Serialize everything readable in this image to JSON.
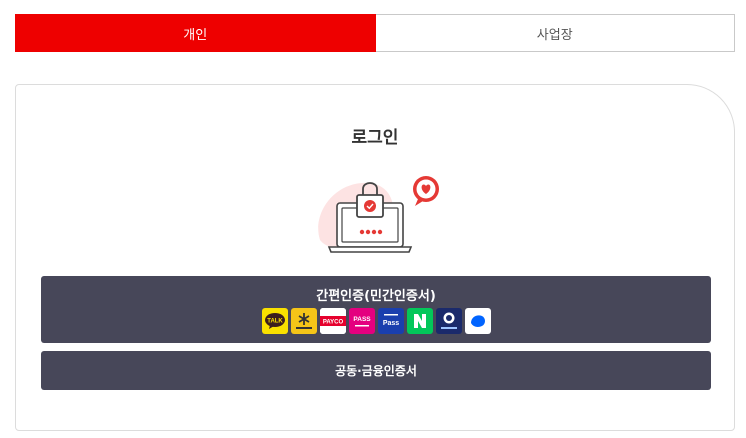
{
  "tabs": [
    {
      "label": "개인",
      "active": true
    },
    {
      "label": "사업장",
      "active": false
    }
  ],
  "login": {
    "title": "로그인",
    "simple_auth_label": "간편인증(민간인증서)",
    "cert_auth_label": "공동·금융인증서",
    "providers": [
      {
        "name": "kakao-icon",
        "text": "TALK",
        "bg": "#fae100",
        "fg": "#3c1e1e"
      },
      {
        "name": "kb-icon",
        "text": "KB",
        "bg": "#f5c518",
        "fg": "#333333"
      },
      {
        "name": "payco-icon",
        "text": "PAYCO",
        "bg": "#ffffff",
        "fg": "#e6002d"
      },
      {
        "name": "pass-pink-icon",
        "text": "PASS",
        "bg": "#e4007f",
        "fg": "#ffffff"
      },
      {
        "name": "pass-blue-icon",
        "text": "Pass",
        "bg": "#1a3fae",
        "fg": "#ffffff"
      },
      {
        "name": "naver-icon",
        "text": "N",
        "bg": "#03c75a",
        "fg": "#ffffff"
      },
      {
        "name": "shinhan-icon",
        "text": "S",
        "bg": "#1b2a6b",
        "fg": "#ffffff"
      },
      {
        "name": "toss-icon",
        "text": "",
        "bg": "#ffffff",
        "fg": "#0064ff"
      }
    ]
  },
  "colors": {
    "accent": "#ee0000",
    "button_bg": "#474759"
  }
}
